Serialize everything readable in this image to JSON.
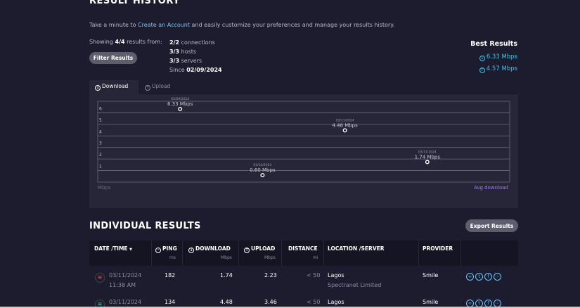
{
  "header": {
    "title": "RESULT HISTORY",
    "intro_before": "Take a minute to ",
    "intro_link": "Create an Account",
    "intro_after": " and easily customize your preferences and manage your results history."
  },
  "summary": {
    "showing_prefix": "Showing ",
    "showing_count": "4/4",
    "showing_suffix": " results from:",
    "filter_label": "Filter Results",
    "connections_count": "2/2",
    "connections_label": " connections",
    "hosts_count": "3/3",
    "hosts_label": " hosts",
    "servers_count": "3/3",
    "servers_label": " servers",
    "since_label": "Since ",
    "since_date": "02/09/2024"
  },
  "best": {
    "title": "Best Results",
    "download": "6.33 Mbps",
    "upload": "4.57 Mbps"
  },
  "tabs": [
    {
      "label": "Download",
      "active": true
    },
    {
      "label": "Upload",
      "active": false
    }
  ],
  "chart_data": {
    "type": "scatter",
    "ylabel": "Mbps",
    "legend": "Avg download",
    "yticks": [
      1,
      2,
      3,
      4,
      5,
      6
    ],
    "ylim": [
      0,
      7
    ],
    "points": [
      {
        "date": "02/09/2024",
        "label": "6.33 Mbps",
        "value": 6.33
      },
      {
        "date": "03/10/2024",
        "label": "0.60 Mbps",
        "value": 0.6
      },
      {
        "date": "03/11/2024",
        "label": "4.48 Mbps",
        "value": 4.48
      },
      {
        "date": "03/11/2024",
        "label": "1.74 Mbps",
        "value": 1.74
      }
    ]
  },
  "results": {
    "title": "INDIVIDUAL RESULTS",
    "export_label": "Export Results",
    "columns": {
      "date": "DATE /TIME",
      "sort_arrow": "▼",
      "ping": "PING",
      "ping_unit": "ms",
      "download": "DOWNLOAD",
      "download_unit": "Mbps",
      "upload": "UPLOAD",
      "upload_unit": "Mbps",
      "distance": "DISTANCE",
      "distance_unit": "mi",
      "location": "LOCATION /SERVER",
      "provider": "PROVIDER"
    },
    "rows": [
      {
        "date": "03/11/2024",
        "time": "11:38 AM",
        "ping": "182",
        "download": "1.74",
        "upload": "2.23",
        "distance": "< 50",
        "location": "Lagos",
        "server": "Spectranet Limited",
        "provider": "Smile",
        "wifi_color": "#e8556b"
      },
      {
        "date": "03/11/2024",
        "time": "",
        "ping": "134",
        "download": "4.48",
        "upload": "3.46",
        "distance": "< 50",
        "location": "Lagos",
        "server": "",
        "provider": "Smile",
        "wifi_color": "#3fd0a8"
      }
    ]
  }
}
